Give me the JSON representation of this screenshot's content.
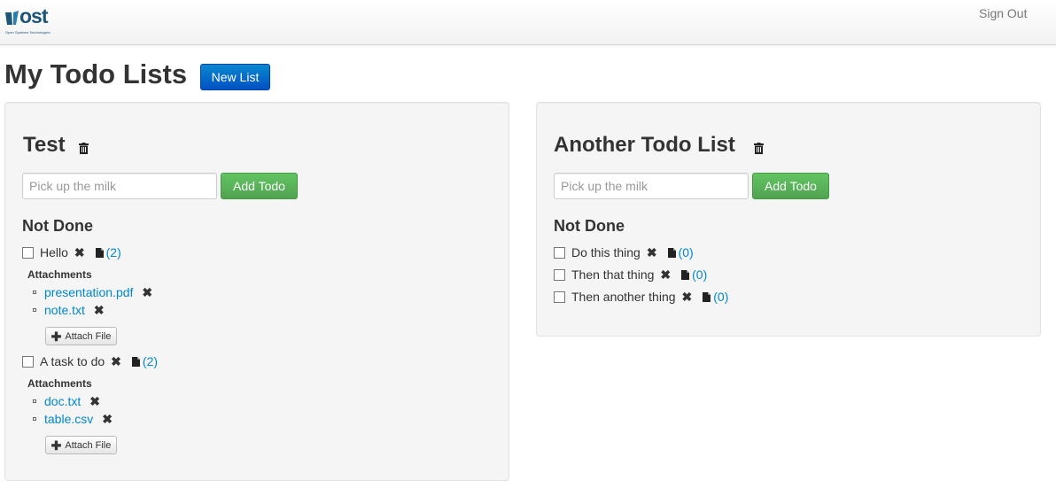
{
  "header": {
    "logo_text": "ost",
    "logo_subtext": "Open Systems Technologies",
    "sign_out": "Sign Out"
  },
  "page": {
    "title": "My Todo Lists",
    "new_list_label": "New List"
  },
  "lists": [
    {
      "title": "Test",
      "input_placeholder": "Pick up the milk",
      "add_label": "Add Todo",
      "section_label": "Not Done",
      "todos": [
        {
          "text": "Hello",
          "count": "(2)",
          "attachments_label": "Attachments",
          "attachments": [
            "presentation.pdf",
            "note.txt"
          ],
          "attach_label": "Attach File"
        },
        {
          "text": "A task to do",
          "count": "(2)",
          "attachments_label": "Attachments",
          "attachments": [
            "doc.txt",
            "table.csv"
          ],
          "attach_label": "Attach File"
        }
      ]
    },
    {
      "title": "Another Todo List",
      "input_placeholder": "Pick up the milk",
      "add_label": "Add Todo",
      "section_label": "Not Done",
      "todos": [
        {
          "text": "Do this thing",
          "count": "(0)"
        },
        {
          "text": "Then that thing",
          "count": "(0)"
        },
        {
          "text": "Then another thing",
          "count": "(0)"
        }
      ]
    }
  ],
  "icons": {
    "trash": "trash-icon",
    "remove": "remove-icon",
    "file": "file-icon",
    "plus": "plus-icon"
  },
  "colors": {
    "link": "#0088cc",
    "primary_button": "#0074cc",
    "success_button": "#51a351",
    "brand": "#1d5577"
  }
}
